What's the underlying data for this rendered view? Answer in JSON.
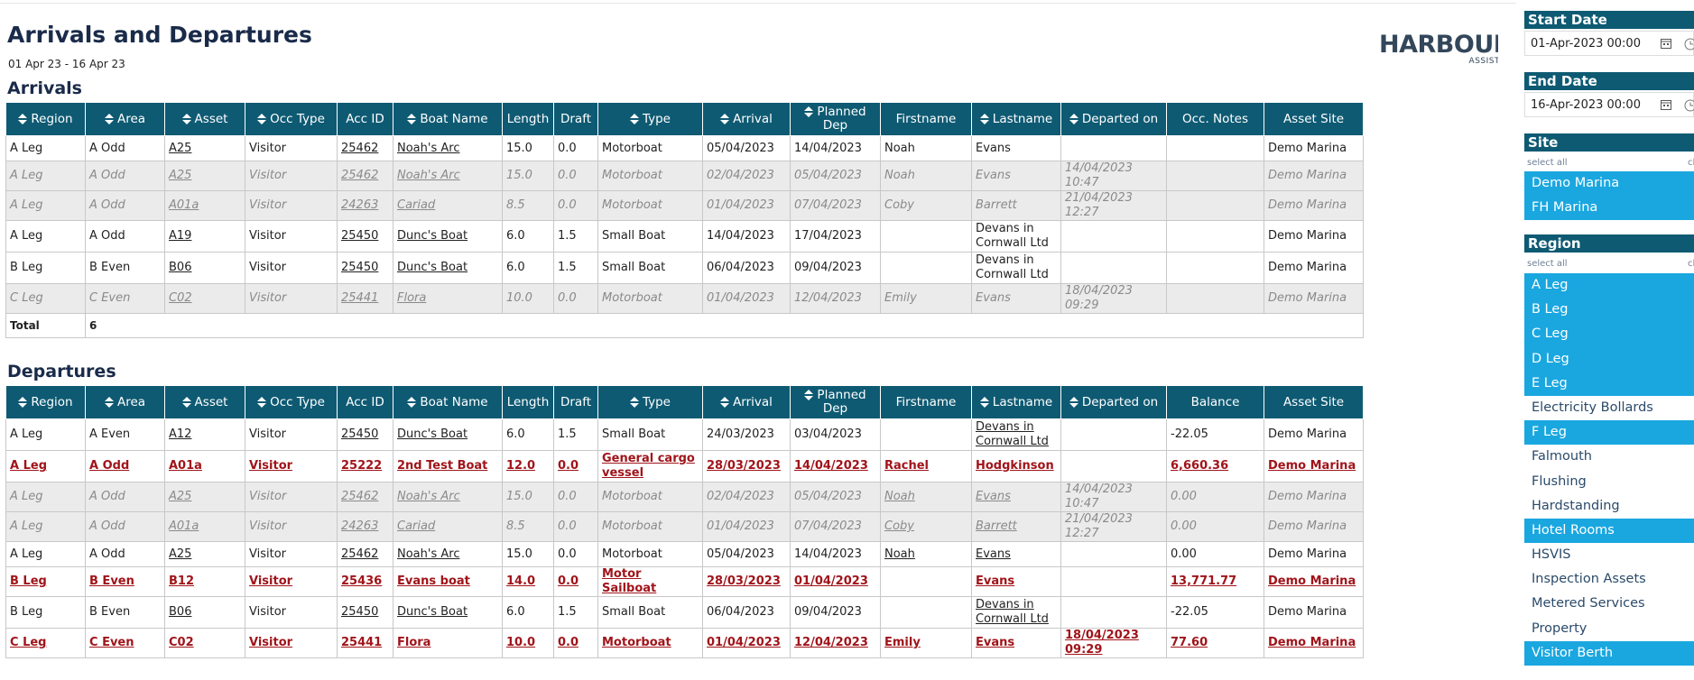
{
  "report": {
    "title": "Arrivals and Departures",
    "date_range": "01 Apr 23 - 16 Apr 23",
    "logo_main": "HARBOUR",
    "logo_sub": "ASSIST"
  },
  "arrivals": {
    "section_title": "Arrivals",
    "headers": [
      "Region",
      "Area",
      "Asset",
      "Occ Type",
      "Acc ID",
      "Boat Name",
      "Length",
      "Draft",
      "Type",
      "Arrival",
      "Planned Dep",
      "Firstname",
      "Lastname",
      "Departed on",
      "Occ. Notes",
      "Asset Site"
    ],
    "sortable": [
      true,
      true,
      true,
      true,
      false,
      true,
      false,
      false,
      true,
      true,
      true,
      false,
      true,
      true,
      false,
      false
    ],
    "rows": [
      {
        "style": "normal",
        "cells": [
          "A Leg",
          "A Odd",
          "A25",
          "Visitor",
          "25462",
          "Noah's Arc",
          "15.0",
          "0.0",
          "Motorboat",
          "05/04/2023",
          "14/04/2023",
          "Noah",
          "Evans",
          "",
          "",
          "Demo Marina"
        ]
      },
      {
        "style": "faded",
        "cells": [
          "A Leg",
          "A Odd",
          "A25",
          "Visitor",
          "25462",
          "Noah's Arc",
          "15.0",
          "0.0",
          "Motorboat",
          "02/04/2023",
          "05/04/2023",
          "Noah",
          "Evans",
          "14/04/2023 10:47",
          "",
          "Demo Marina"
        ]
      },
      {
        "style": "faded",
        "cells": [
          "A Leg",
          "A Odd",
          "A01a",
          "Visitor",
          "24263",
          "Cariad",
          "8.5",
          "0.0",
          "Motorboat",
          "01/04/2023",
          "07/04/2023",
          "Coby",
          "Barrett",
          "21/04/2023 12:27",
          "",
          "Demo Marina"
        ]
      },
      {
        "style": "normal",
        "cells": [
          "A Leg",
          "A Odd",
          "A19",
          "Visitor",
          "25450",
          "Dunc's Boat",
          "6.0",
          "1.5",
          "Small Boat",
          "14/04/2023",
          "17/04/2023",
          "",
          "Devans in Cornwall Ltd",
          "",
          "",
          "Demo Marina"
        ]
      },
      {
        "style": "normal",
        "cells": [
          "B Leg",
          "B Even",
          "B06",
          "Visitor",
          "25450",
          "Dunc's Boat",
          "6.0",
          "1.5",
          "Small Boat",
          "06/04/2023",
          "09/04/2023",
          "",
          "Devans in Cornwall Ltd",
          "",
          "",
          "Demo Marina"
        ]
      },
      {
        "style": "faded",
        "cells": [
          "C Leg",
          "C Even",
          "C02",
          "Visitor",
          "25441",
          "Flora",
          "10.0",
          "0.0",
          "Motorboat",
          "01/04/2023",
          "12/04/2023",
          "Emily",
          "Evans",
          "18/04/2023 09:29",
          "",
          "Demo Marina"
        ]
      }
    ],
    "total_label": "Total",
    "total_value": "6"
  },
  "departures": {
    "section_title": "Departures",
    "headers": [
      "Region",
      "Area",
      "Asset",
      "Occ Type",
      "Acc ID",
      "Boat Name",
      "Length",
      "Draft",
      "Type",
      "Arrival",
      "Planned Dep",
      "Firstname",
      "Lastname",
      "Departed on",
      "Balance",
      "Asset Site"
    ],
    "sortable": [
      true,
      true,
      true,
      true,
      false,
      true,
      false,
      false,
      true,
      true,
      true,
      false,
      true,
      true,
      false,
      false
    ],
    "rows": [
      {
        "style": "normal",
        "cells": [
          "A Leg",
          "A Even",
          "A12",
          "Visitor",
          "25450",
          "Dunc's Boat",
          "6.0",
          "1.5",
          "Small Boat",
          "24/03/2023",
          "03/04/2023",
          "",
          "Devans in Cornwall Ltd",
          "",
          "-22.05",
          "Demo Marina"
        ]
      },
      {
        "style": "flag",
        "cells": [
          "A Leg",
          "A Odd",
          "A01a",
          "Visitor",
          "25222",
          "2nd Test Boat",
          "12.0",
          "0.0",
          "General cargo vessel",
          "28/03/2023",
          "14/04/2023",
          "Rachel",
          "Hodgkinson",
          "",
          "6,660.36",
          "Demo Marina"
        ]
      },
      {
        "style": "faded",
        "cells": [
          "A Leg",
          "A Odd",
          "A25",
          "Visitor",
          "25462",
          "Noah's Arc",
          "15.0",
          "0.0",
          "Motorboat",
          "02/04/2023",
          "05/04/2023",
          "Noah",
          "Evans",
          "14/04/2023 10:47",
          "0.00",
          "Demo Marina"
        ]
      },
      {
        "style": "faded",
        "cells": [
          "A Leg",
          "A Odd",
          "A01a",
          "Visitor",
          "24263",
          "Cariad",
          "8.5",
          "0.0",
          "Motorboat",
          "01/04/2023",
          "07/04/2023",
          "Coby",
          "Barrett",
          "21/04/2023 12:27",
          "0.00",
          "Demo Marina"
        ]
      },
      {
        "style": "normal",
        "cells": [
          "A Leg",
          "A Odd",
          "A25",
          "Visitor",
          "25462",
          "Noah's Arc",
          "15.0",
          "0.0",
          "Motorboat",
          "05/04/2023",
          "14/04/2023",
          "Noah",
          "Evans",
          "",
          "0.00",
          "Demo Marina"
        ]
      },
      {
        "style": "flag",
        "cells": [
          "B Leg",
          "B Even",
          "B12",
          "Visitor",
          "25436",
          "Evans boat",
          "14.0",
          "0.0",
          "Motor Sailboat",
          "28/03/2023",
          "01/04/2023",
          "",
          "Evans",
          "",
          "13,771.77",
          "Demo Marina"
        ]
      },
      {
        "style": "normal",
        "cells": [
          "B Leg",
          "B Even",
          "B06",
          "Visitor",
          "25450",
          "Dunc's Boat",
          "6.0",
          "1.5",
          "Small Boat",
          "06/04/2023",
          "09/04/2023",
          "",
          "Devans in Cornwall Ltd",
          "",
          "-22.05",
          "Demo Marina"
        ]
      },
      {
        "style": "flag",
        "cells": [
          "C Leg",
          "C Even",
          "C02",
          "Visitor",
          "25441",
          "Flora",
          "10.0",
          "0.0",
          "Motorboat",
          "01/04/2023",
          "12/04/2023",
          "Emily",
          "Evans",
          "18/04/2023 09:29",
          "77.60",
          "Demo Marina"
        ]
      }
    ]
  },
  "filters": {
    "start_date": {
      "label": "Start Date",
      "value": "01-Apr-2023 00:00"
    },
    "end_date": {
      "label": "End Date",
      "value": "16-Apr-2023 00:00"
    },
    "site": {
      "label": "Site",
      "select_all": "select all",
      "clear": "cl",
      "items": [
        {
          "label": "Demo Marina",
          "selected": true
        },
        {
          "label": "FH Marina",
          "selected": true
        }
      ]
    },
    "region": {
      "label": "Region",
      "select_all": "select all",
      "clear": "cl",
      "items": [
        {
          "label": "A Leg",
          "selected": true
        },
        {
          "label": "B Leg",
          "selected": true
        },
        {
          "label": "C Leg",
          "selected": true
        },
        {
          "label": "D Leg",
          "selected": true
        },
        {
          "label": "E Leg",
          "selected": true
        },
        {
          "label": "Electricity Bollards",
          "selected": false
        },
        {
          "label": "F Leg",
          "selected": true
        },
        {
          "label": "Falmouth",
          "selected": false
        },
        {
          "label": "Flushing",
          "selected": false
        },
        {
          "label": "Hardstanding",
          "selected": false
        },
        {
          "label": "Hotel Rooms",
          "selected": true
        },
        {
          "label": "HSVIS",
          "selected": false
        },
        {
          "label": "Inspection Assets",
          "selected": false
        },
        {
          "label": "Metered Services",
          "selected": false
        },
        {
          "label": "Property",
          "selected": false
        },
        {
          "label": "Visitor Berth",
          "selected": true
        }
      ]
    }
  },
  "colors": {
    "header_bg": "#0e5a73",
    "selected_item": "#1aa7e0",
    "flag_text": "#a0141a",
    "faded_row": "#ebebeb"
  }
}
